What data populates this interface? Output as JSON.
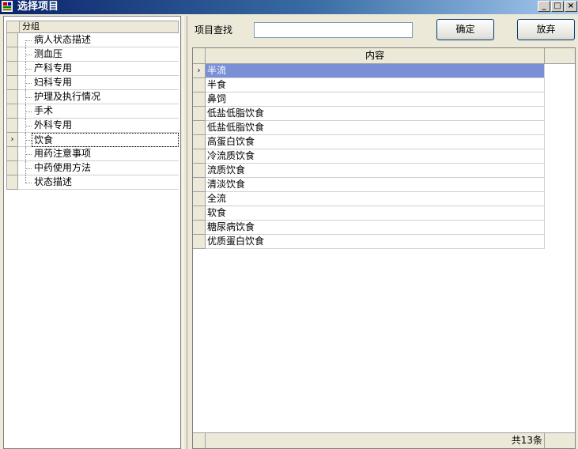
{
  "window": {
    "title": "选择项目",
    "icon": "app-grid-icon",
    "controls": {
      "minimize": "_",
      "maximize": "□",
      "close": "×"
    }
  },
  "tree": {
    "header": "分组",
    "selected_marker": "›",
    "items": [
      {
        "label": "病人状态描述",
        "selected": false
      },
      {
        "label": "测血压",
        "selected": false
      },
      {
        "label": "产科专用",
        "selected": false
      },
      {
        "label": "妇科专用",
        "selected": false
      },
      {
        "label": "护理及执行情况",
        "selected": false
      },
      {
        "label": "手术",
        "selected": false
      },
      {
        "label": "外科专用",
        "selected": false
      },
      {
        "label": "饮食",
        "selected": true
      },
      {
        "label": "用药注意事项",
        "selected": false
      },
      {
        "label": "中药使用方法",
        "selected": false
      },
      {
        "label": "状态描述",
        "selected": false
      }
    ]
  },
  "search": {
    "label": "项目查找",
    "value": "",
    "placeholder": ""
  },
  "buttons": {
    "confirm": "确定",
    "cancel": "放弃"
  },
  "grid": {
    "column": "内容",
    "current_marker": "›",
    "rows": [
      "半流",
      "半食",
      "鼻饲",
      "低盐低脂饮食",
      "低盐低脂饮食",
      "高蛋白饮食",
      "冷流质饮食",
      "流质饮食",
      "清淡饮食",
      "全流",
      "软食",
      "糖尿病饮食",
      "优质蛋白饮食"
    ],
    "selected_index": 0,
    "footer": "共13条"
  },
  "colors": {
    "title_start": "#0a246a",
    "title_end": "#a6caf0",
    "selection": "#7b8fd6",
    "face": "#ece9d8"
  }
}
